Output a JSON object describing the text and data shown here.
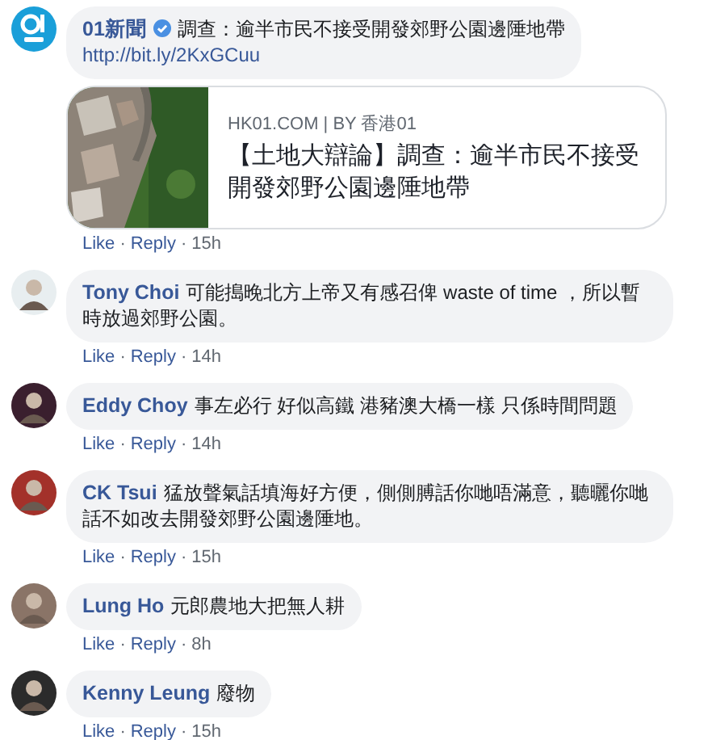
{
  "separator": "·",
  "comments": [
    {
      "kind": "post",
      "author": "01新聞",
      "verified": true,
      "text": "調查：逾半市民不接受開發郊野公園邊陲地帶",
      "link": "http://bit.ly/2KxGCuu",
      "preview": {
        "kind": "picture",
        "source": "HK01.COM | BY 香港01",
        "headline": "【土地大辯論】調查：逾半市民不接受開發郊野公園邊陲地帶"
      },
      "actions": [
        "Like",
        "Reply"
      ],
      "time": "15h"
    },
    {
      "kind": "comment",
      "author": "Tony Choi",
      "text": "可能搗晚北方上帝又有感召俾 waste of time ，所以暫時放過郊野公園。",
      "actions": [
        "Like",
        "Reply"
      ],
      "time": "14h"
    },
    {
      "kind": "comment",
      "author": "Eddy Choy",
      "text": "事左必行 好似高鐵 港豬澳大橋一樣 只係時間問題",
      "actions": [
        "Like",
        "Reply"
      ],
      "time": "14h"
    },
    {
      "kind": "comment",
      "author": "CK Tsui",
      "text": "猛放聲氣話填海好方便，側側膊話你哋唔滿意，聽曬你哋話不如改去開發郊野公園邊陲地。",
      "actions": [
        "Like",
        "Reply"
      ],
      "time": "15h"
    },
    {
      "kind": "comment",
      "author": "Lung Ho",
      "text": "元郎農地大把無人耕",
      "actions": [
        "Like",
        "Reply"
      ],
      "time": "8h"
    },
    {
      "kind": "comment",
      "author": "Kenny Leung",
      "text": "廢物",
      "actions": [
        "Like",
        "Reply"
      ],
      "time": "15h"
    }
  ]
}
